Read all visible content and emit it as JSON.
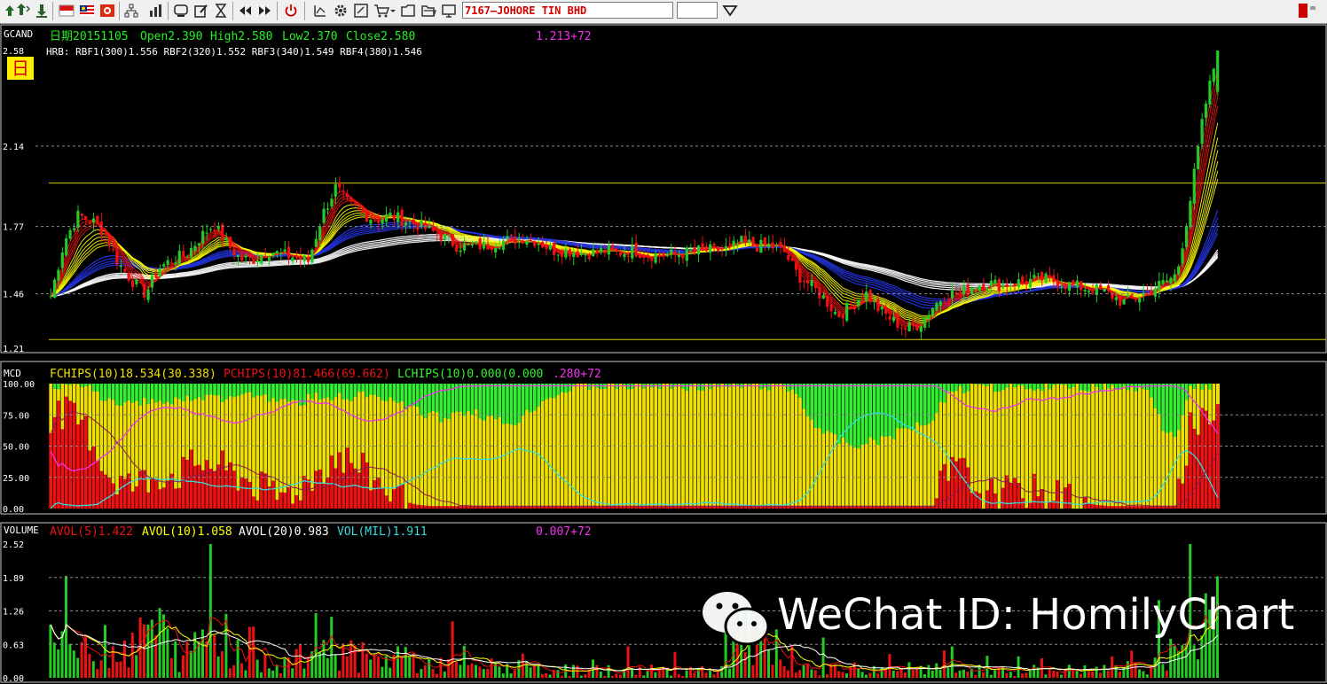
{
  "toolbar": {
    "symbol": "7167—JOHORE TIN BHD",
    "icons": [
      "arrow-up-icon",
      "arrow-down-icon",
      "flag-sg-icon",
      "flag-my-icon",
      "flag-hk-icon",
      "tree-icon",
      "bar-chart-icon",
      "screen-icon",
      "edit-icon",
      "hourglass-icon",
      "rewind-icon",
      "forward-icon",
      "power-icon",
      "draw-icon",
      "gear-icon",
      "tool-icon",
      "cart-icon",
      "folder-icon",
      "folder-open-icon",
      "monitor-icon"
    ]
  },
  "panels": {
    "price": {
      "label": "GCAND",
      "info": {
        "date": "日期20151105",
        "open": "Open2.390",
        "high": "High2.580",
        "low": "Low2.370",
        "close": "Close2.580",
        "extra": "1.213+72"
      },
      "hrb": "HRB: RBF1(300)1.556  RBF2(320)1.552  RBF3(340)1.549  RBF4(380)1.546",
      "period_badge": "日",
      "y_ticks": [
        "2.58",
        "2.14",
        "1.77",
        "1.46",
        "1.21"
      ]
    },
    "mcd": {
      "label": "MCD",
      "fchips": "FCHIPS(10)18.534(30.338)",
      "pchips": "PCHIPS(10)81.466(69.662)",
      "lchips": "LCHIPS(10)0.000(0.000",
      "extra": ".280+72",
      "y_ticks": [
        "100.00",
        "75.00",
        "50.00",
        "25.00",
        "0.00"
      ]
    },
    "volume": {
      "label": "VOLUME",
      "avol5": "AVOL(5)1.422",
      "avol10": "AVOL(10)1.058",
      "avol20": "AVOL(20)0.983",
      "vol": "VOL(MIL)1.911",
      "extra": "0.007+72",
      "y_ticks": [
        "2.52",
        "1.89",
        "1.26",
        "0.63",
        "0.00"
      ]
    }
  },
  "watermark": "WeChat ID: HomilyChart",
  "colors": {
    "up": "#22cc22",
    "down": "#ee1111",
    "yellow": "#ffff00",
    "fchips": "#f0e000",
    "pchips": "#ee1111",
    "lchips": "#33ee33",
    "magenta": "#ee33ee",
    "cyan": "#33dddd",
    "blue": "#2233dd",
    "white": "#ffffff"
  },
  "chart_data": [
    {
      "type": "candlestick",
      "title": "GCAND",
      "ylim": [
        1.21,
        2.58
      ],
      "y_ticks": [
        2.58,
        2.14,
        1.77,
        1.46,
        1.21
      ],
      "horizontal_lines": [
        1.97,
        1.25
      ],
      "last_bar": {
        "open": 2.39,
        "high": 2.58,
        "low": 2.37,
        "close": 2.58
      },
      "ma_groups": [
        "red short-term MAs",
        "yellow mid-term MAs",
        "blue long-term MAs",
        "white very long-term MAs"
      ],
      "close_profile": [
        1.45,
        1.7,
        1.82,
        1.8,
        1.74,
        1.6,
        1.52,
        1.46,
        1.58,
        1.62,
        1.64,
        1.72,
        1.78,
        1.69,
        1.62,
        1.62,
        1.66,
        1.64,
        1.63,
        1.61,
        1.82,
        1.95,
        1.87,
        1.83,
        1.8,
        1.82,
        1.8,
        1.78,
        1.75,
        1.72,
        1.68,
        1.68,
        1.68,
        1.7,
        1.71,
        1.72,
        1.7,
        1.66,
        1.66,
        1.65,
        1.65,
        1.66,
        1.65,
        1.66,
        1.64,
        1.64,
        1.64,
        1.65,
        1.66,
        1.66,
        1.67,
        1.7,
        1.68,
        1.68,
        1.66,
        1.55,
        1.5,
        1.44,
        1.36,
        1.4,
        1.47,
        1.39,
        1.34,
        1.3,
        1.32,
        1.4,
        1.46,
        1.46,
        1.5,
        1.51,
        1.5,
        1.51,
        1.52,
        1.53,
        1.52,
        1.5,
        1.49,
        1.48,
        1.46,
        1.42,
        1.44,
        1.48,
        1.51,
        1.55,
        1.9,
        2.3,
        2.58
      ]
    },
    {
      "type": "area",
      "title": "MCD",
      "ylim": [
        0,
        100
      ],
      "y_ticks": [
        100,
        75,
        50,
        25,
        0
      ],
      "series": [
        {
          "name": "FCHIPS(10)",
          "values": [
            18.534
          ]
        },
        {
          "name": "PCHIPS(10)",
          "values": [
            81.466
          ]
        },
        {
          "name": "LCHIPS(10)",
          "values": [
            0.0
          ]
        }
      ],
      "pchips_profile": [
        75,
        76,
        70,
        58,
        30,
        22,
        18,
        22,
        28,
        26,
        30,
        38,
        35,
        30,
        25,
        20,
        12,
        10,
        15,
        22,
        32,
        42,
        38,
        30,
        22,
        14,
        6,
        3,
        2,
        2,
        2,
        2,
        2,
        2,
        2,
        2,
        2,
        2,
        2,
        2,
        2,
        2,
        2,
        2,
        2,
        2,
        2,
        2,
        2,
        2,
        2,
        2,
        2,
        2,
        2,
        2,
        2,
        2,
        2,
        2,
        2,
        2,
        2,
        2,
        2,
        2,
        28,
        32,
        18,
        10,
        12,
        12,
        14,
        12,
        10,
        8,
        6,
        3,
        2,
        2,
        2,
        2,
        2,
        2,
        68,
        72,
        82
      ],
      "lchips_profile": [
        2,
        2,
        2,
        5,
        12,
        18,
        16,
        12,
        15,
        14,
        12,
        14,
        10,
        12,
        10,
        8,
        12,
        15,
        16,
        12,
        10,
        10,
        12,
        10,
        12,
        15,
        18,
        22,
        25,
        28,
        22,
        22,
        26,
        30,
        32,
        25,
        15,
        10,
        5,
        2,
        2,
        2,
        2,
        2,
        2,
        2,
        2,
        2,
        2,
        2,
        2,
        2,
        2,
        2,
        2,
        8,
        28,
        40,
        45,
        50,
        48,
        45,
        42,
        36,
        32,
        28,
        10,
        5,
        3,
        3,
        3,
        3,
        3,
        3,
        3,
        3,
        3,
        3,
        3,
        3,
        5,
        5,
        35,
        40,
        5,
        3,
        3
      ]
    },
    {
      "type": "bar",
      "title": "VOLUME",
      "ylim": [
        0,
        2.52
      ],
      "y_ticks": [
        2.52,
        1.89,
        1.26,
        0.63,
        0.0
      ],
      "series": [
        {
          "name": "AVOL(5)",
          "values": [
            1.422
          ]
        },
        {
          "name": "AVOL(10)",
          "values": [
            1.058
          ]
        },
        {
          "name": "AVOL(20)",
          "values": [
            0.983
          ]
        },
        {
          "name": "VOL(MIL)",
          "values": [
            1.911
          ]
        }
      ],
      "volume_profile": [
        0.9,
        0.7,
        0.6,
        0.4,
        0.8,
        0.6,
        0.5,
        1.0,
        1.0,
        0.5,
        0.4,
        0.8,
        1.5,
        0.7,
        0.5,
        0.6,
        0.4,
        0.3,
        0.3,
        0.5,
        0.9,
        0.7,
        0.5,
        0.4,
        0.3,
        0.4,
        0.5,
        0.3,
        0.2,
        0.3,
        0.25,
        0.2,
        0.2,
        0.25,
        0.2,
        0.2,
        0.15,
        0.15,
        0.15,
        0.15,
        0.15,
        0.15,
        0.15,
        0.15,
        0.15,
        0.15,
        0.15,
        0.15,
        0.2,
        0.15,
        0.3,
        1.0,
        0.8,
        0.4,
        0.2,
        0.15,
        0.15,
        0.2,
        0.2,
        0.2,
        0.15,
        0.15,
        0.2,
        0.2,
        0.15,
        0.15,
        0.2,
        0.15,
        0.15,
        0.15,
        0.15,
        0.15,
        0.15,
        0.15,
        0.15,
        0.15,
        0.15,
        0.15,
        0.15,
        0.2,
        0.2,
        0.3,
        0.4,
        0.5,
        0.9,
        1.0,
        1.4
      ]
    }
  ]
}
